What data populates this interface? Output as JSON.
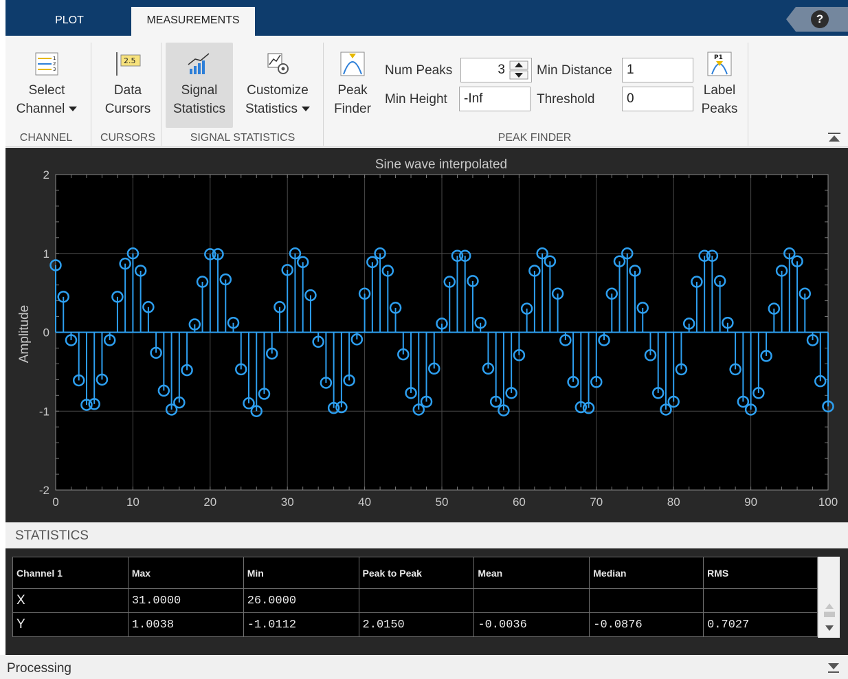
{
  "tabs": {
    "plot": "PLOT",
    "measurements": "MEASUREMENTS",
    "help": "?"
  },
  "ribbon": {
    "channel": {
      "select_channel": [
        "Select",
        "Channel"
      ],
      "group": "CHANNEL"
    },
    "cursors": {
      "data_cursors": [
        "Data",
        "Cursors"
      ],
      "icon_text": "2.5",
      "group": "CURSORS"
    },
    "signal_statistics": {
      "signal_statistics": [
        "Signal",
        "Statistics"
      ],
      "customize_statistics": [
        "Customize",
        "Statistics"
      ],
      "group": "SIGNAL STATISTICS"
    },
    "peak_finder": {
      "peak_finder": [
        "Peak",
        "Finder"
      ],
      "num_peaks_label": "Num Peaks",
      "num_peaks_value": "3",
      "min_height_label": "Min Height",
      "min_height_value": "-Inf",
      "min_distance_label": "Min Distance",
      "min_distance_value": "1",
      "threshold_label": "Threshold",
      "threshold_value": "0",
      "label_peaks": [
        "Label",
        "Peaks"
      ],
      "label_peaks_icon_text": "P1",
      "group": "PEAK FINDER"
    }
  },
  "colors": {
    "series": "#2d9ff0",
    "background": "#000000",
    "grid": "#4a4a4a",
    "axis_text": "#c8c8c8"
  },
  "chart_data": {
    "type": "stem",
    "title": "Sine wave interpolated",
    "xlabel": "",
    "ylabel": "Amplitude",
    "xlim": [
      0,
      100
    ],
    "ylim": [
      -2,
      2
    ],
    "xticks": [
      0,
      10,
      20,
      30,
      40,
      50,
      60,
      70,
      80,
      90,
      100
    ],
    "yticks": [
      -2,
      -1,
      0,
      1,
      2
    ],
    "grid": true,
    "series": [
      {
        "x": [
          0,
          1,
          2,
          3,
          4,
          5,
          6,
          7,
          8,
          9,
          10,
          11,
          12,
          13,
          14,
          15,
          16,
          17,
          18,
          19,
          20,
          21,
          22,
          23,
          24,
          25,
          26,
          27,
          28,
          29,
          30,
          31,
          32,
          33,
          34,
          35,
          36,
          37,
          38,
          39,
          40,
          41,
          42,
          43,
          44,
          45,
          46,
          47,
          48,
          49,
          50,
          51,
          52,
          53,
          54,
          55,
          56,
          57,
          58,
          59,
          60,
          61,
          62,
          63,
          64,
          65,
          66,
          67,
          68,
          69,
          70,
          71,
          72,
          73,
          74,
          75,
          76,
          77,
          78,
          79,
          80,
          81,
          82,
          83,
          84,
          85,
          86,
          87,
          88,
          89,
          90,
          91,
          92,
          93,
          94,
          95,
          96,
          97,
          98,
          99,
          100
        ],
        "y": [
          0.85,
          0.45,
          -0.1,
          -0.61,
          -0.92,
          -0.91,
          -0.6,
          -0.1,
          0.45,
          0.87,
          1.0,
          0.78,
          0.32,
          -0.26,
          -0.74,
          -0.98,
          -0.89,
          -0.48,
          0.1,
          0.64,
          0.99,
          0.99,
          0.67,
          0.12,
          -0.47,
          -0.9,
          -1.0,
          -0.78,
          -0.27,
          0.32,
          0.79,
          1.0,
          0.89,
          0.47,
          -0.12,
          -0.64,
          -0.96,
          -0.95,
          -0.61,
          -0.09,
          0.49,
          0.89,
          1.0,
          0.78,
          0.31,
          -0.28,
          -0.77,
          -0.98,
          -0.88,
          -0.46,
          0.11,
          0.64,
          0.97,
          0.97,
          0.65,
          0.12,
          -0.46,
          -0.88,
          -0.99,
          -0.77,
          -0.29,
          0.3,
          0.78,
          1.0,
          0.9,
          0.49,
          -0.1,
          -0.63,
          -0.95,
          -0.96,
          -0.63,
          -0.1,
          0.49,
          0.9,
          1.0,
          0.78,
          0.31,
          -0.29,
          -0.77,
          -0.98,
          -0.88,
          -0.47,
          0.11,
          0.64,
          0.97,
          0.97,
          0.65,
          0.12,
          -0.47,
          -0.88,
          -0.98,
          -0.77,
          -0.3,
          0.3,
          0.78,
          1.0,
          0.9,
          0.49,
          -0.1,
          -0.62,
          -0.94
        ]
      }
    ]
  },
  "statistics": {
    "header": "STATISTICS",
    "columns": [
      "Channel 1",
      "Max",
      "Min",
      "Peak to Peak",
      "Mean",
      "Median",
      "RMS"
    ],
    "rows": [
      [
        "X",
        "31.0000",
        "26.0000",
        "",
        "",
        "",
        ""
      ],
      [
        "Y",
        "1.0038",
        "-1.0112",
        "2.0150",
        "-0.0036",
        "-0.0876",
        "0.7027"
      ]
    ]
  },
  "status": {
    "text": "Processing"
  }
}
